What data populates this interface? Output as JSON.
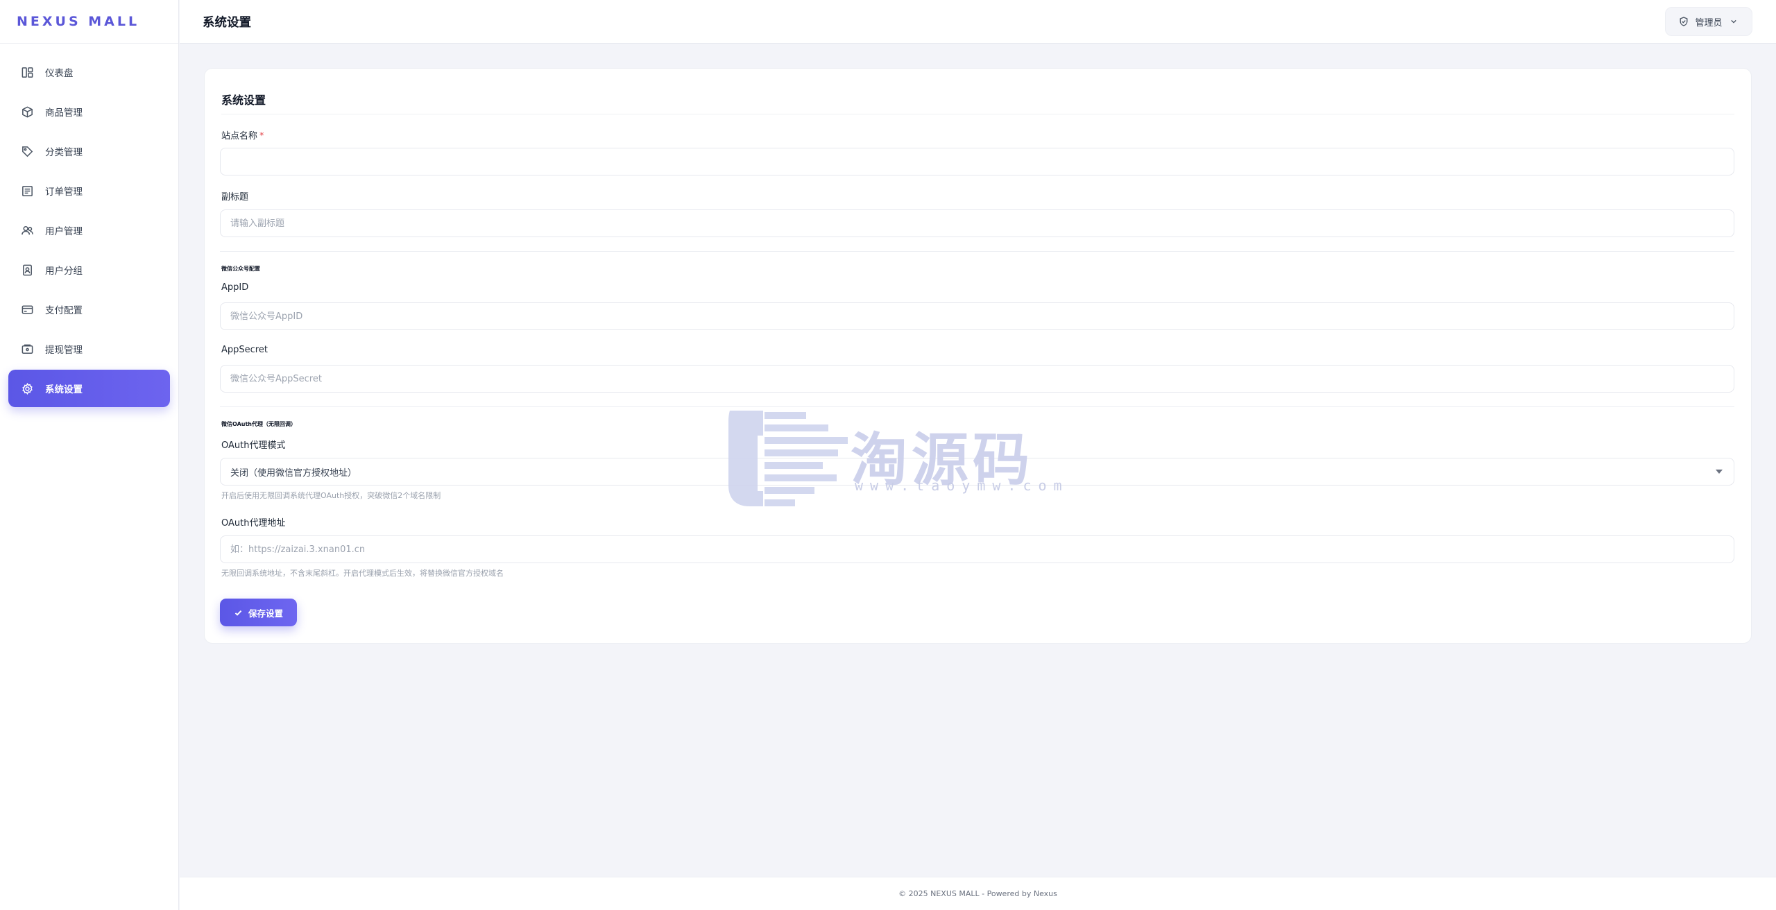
{
  "brand": "NEXUS MALL",
  "sidebar": {
    "items": [
      {
        "label": "仪表盘",
        "icon": "dashboard-icon"
      },
      {
        "label": "商品管理",
        "icon": "box-icon"
      },
      {
        "label": "分类管理",
        "icon": "tag-icon"
      },
      {
        "label": "订单管理",
        "icon": "order-icon"
      },
      {
        "label": "用户管理",
        "icon": "users-icon"
      },
      {
        "label": "用户分组",
        "icon": "user-badge-icon"
      },
      {
        "label": "支付配置",
        "icon": "card-icon"
      },
      {
        "label": "提现管理",
        "icon": "wallet-icon"
      },
      {
        "label": "系统设置",
        "icon": "gear-icon",
        "active": true
      }
    ]
  },
  "header": {
    "title": "系统设置",
    "user_label": "管理员"
  },
  "form": {
    "title": "系统设置",
    "site_name": {
      "label": "站点名称",
      "required_mark": "*",
      "value": "",
      "placeholder": ""
    },
    "subtitle": {
      "label": "副标题",
      "value": "",
      "placeholder": "请输入副标题"
    },
    "wechat_section": "微信公众号配置",
    "appid": {
      "label": "AppID",
      "value": "",
      "placeholder": "微信公众号AppID"
    },
    "appsecret": {
      "label": "AppSecret",
      "value": "",
      "placeholder": "微信公众号AppSecret"
    },
    "oauth_section": "微信OAuth代理（无限回调）",
    "oauth_mode": {
      "label": "OAuth代理模式",
      "selected": "关闭（使用微信官方授权地址）",
      "hint": "开启后使用无限回调系统代理OAuth授权，突破微信2个域名限制"
    },
    "oauth_url": {
      "label": "OAuth代理地址",
      "value": "",
      "placeholder": "如：https://zaizai.3.xnan01.cn",
      "hint": "无限回调系统地址，不含末尾斜杠。开启代理模式后生效，将替换微信官方授权域名"
    },
    "save_label": "保存设置"
  },
  "watermark": {
    "text": "淘源码",
    "sub": "www.taoymw.com"
  },
  "footer": "© 2025 NEXUS MALL - Powered by Nexus",
  "colors": {
    "accent": "#5b57e6",
    "background": "#f3f4f9"
  }
}
